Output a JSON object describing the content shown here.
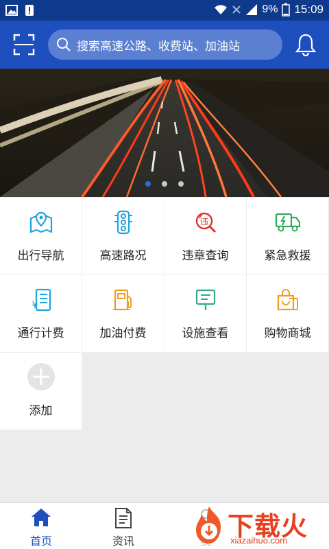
{
  "status_bar": {
    "battery": "9%",
    "time": "15:09"
  },
  "search": {
    "placeholder": "搜索高速公路、收费站、加油站"
  },
  "banner": {
    "slides": 3,
    "active_slide": 1
  },
  "services": [
    {
      "label": "出行导航",
      "icon": "map-navigation-icon",
      "color": "#1fa3dc"
    },
    {
      "label": "高速路况",
      "icon": "traffic-light-icon",
      "color": "#1fa3dc"
    },
    {
      "label": "违章查询",
      "icon": "violation-search-icon",
      "color": "#e0322b"
    },
    {
      "label": "紧急救援",
      "icon": "rescue-truck-icon",
      "color": "#2eaa5b"
    },
    {
      "label": "通行计费",
      "icon": "toll-fee-icon",
      "color": "#1fa3dc"
    },
    {
      "label": "加油付费",
      "icon": "fuel-pump-icon",
      "color": "#f29b1b"
    },
    {
      "label": "设施查看",
      "icon": "facility-sign-icon",
      "color": "#2eaa8a"
    },
    {
      "label": "购物商城",
      "icon": "shopping-bag-icon",
      "color": "#f29b1b"
    },
    {
      "label": "添加",
      "icon": "add-icon",
      "color": "#d8d8d8"
    }
  ],
  "tabbar": {
    "tabs": [
      {
        "label": "首页",
        "icon": "home-icon",
        "active": true
      },
      {
        "label": "资讯",
        "icon": "news-icon",
        "active": false
      },
      {
        "label": "我",
        "icon": "profile-icon",
        "active": false
      }
    ]
  },
  "watermark": {
    "text": "下载火",
    "url": "xiazaihuo.com"
  },
  "colors": {
    "header": "#1e4fbf",
    "status_bar": "#0f3a8c",
    "accent": "#1e4fbf"
  }
}
